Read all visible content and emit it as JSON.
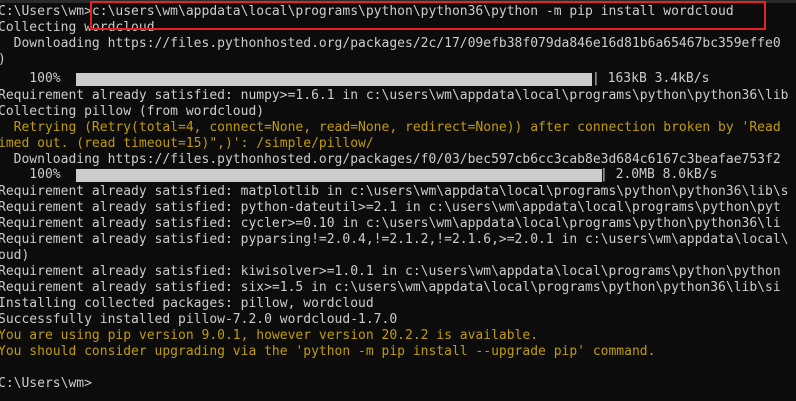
{
  "terminal": {
    "lines": [
      {
        "text": "C:\\Users\\wm>c:\\users\\wm\\appdata\\local\\programs\\python\\python36\\python -m pip install wordcloud",
        "color": "w"
      },
      {
        "text": "Collecting wordcloud",
        "color": "w"
      },
      {
        "text": "  Downloading https://files.pythonhosted.org/packages/2c/17/09efb38f079da846e16d81b6a65467bc359effe0",
        "color": "w"
      },
      {
        "text": ")",
        "color": "w"
      },
      {
        "text": "    100%",
        "color": "w"
      },
      {
        "text": "Requirement already satisfied: numpy>=1.6.1 in c:\\users\\wm\\appdata\\local\\programs\\python\\python36\\lib",
        "color": "w"
      },
      {
        "text": "Collecting pillow (from wordcloud)",
        "color": "w"
      },
      {
        "text": "  Retrying (Retry(total=4, connect=None, read=None, redirect=None)) after connection broken by 'Read",
        "color": "y"
      },
      {
        "text": "imed out. (read timeout=15)\",)': /simple/pillow/",
        "color": "y"
      },
      {
        "text": "  Downloading https://files.pythonhosted.org/packages/f0/03/bec597cb6cc3cab8e3d684c6167c3beafae753f2",
        "color": "w"
      },
      {
        "text": "    100%",
        "color": "w"
      },
      {
        "text": "Requirement already satisfied: matplotlib in c:\\users\\wm\\appdata\\local\\programs\\python\\python36\\lib\\s",
        "color": "w"
      },
      {
        "text": "Requirement already satisfied: python-dateutil>=2.1 in c:\\users\\wm\\appdata\\local\\programs\\python\\pyt",
        "color": "w"
      },
      {
        "text": "Requirement already satisfied: cycler>=0.10 in c:\\users\\wm\\appdata\\local\\programs\\python\\python36\\li",
        "color": "w"
      },
      {
        "text": "Requirement already satisfied: pyparsing!=2.0.4,!=2.1.2,!=2.1.6,>=2.0.1 in c:\\users\\wm\\appdata\\local\\",
        "color": "w"
      },
      {
        "text": "oud)",
        "color": "w"
      },
      {
        "text": "Requirement already satisfied: kiwisolver>=1.0.1 in c:\\users\\wm\\appdata\\local\\programs\\python\\python",
        "color": "w"
      },
      {
        "text": "Requirement already satisfied: six>=1.5 in c:\\users\\wm\\appdata\\local\\programs\\python\\python36\\lib\\si",
        "color": "w"
      },
      {
        "text": "Installing collected packages: pillow, wordcloud",
        "color": "w"
      },
      {
        "text": "Successfully installed pillow-7.2.0 wordcloud-1.7.0",
        "color": "w"
      },
      {
        "text": "You are using pip version 9.0.1, however version 20.2.2 is available.",
        "color": "y"
      },
      {
        "text": "You should consider upgrading via the 'python -m pip install --upgrade pip' command.",
        "color": "y"
      },
      {
        "text": "",
        "color": "w"
      },
      {
        "text": "C:\\Users\\wm>",
        "color": "w"
      }
    ],
    "progress": [
      {
        "line": 4,
        "percent": 100,
        "right": "| 163kB 3.4kB/s"
      },
      {
        "line": 10,
        "percent": 100,
        "right": "| 2.0MB 8.0kB/s"
      }
    ],
    "colors": {
      "background": "#0c0c0c",
      "text": "#cccccc",
      "warning": "#c19c00",
      "highlight": "#e52320"
    }
  }
}
